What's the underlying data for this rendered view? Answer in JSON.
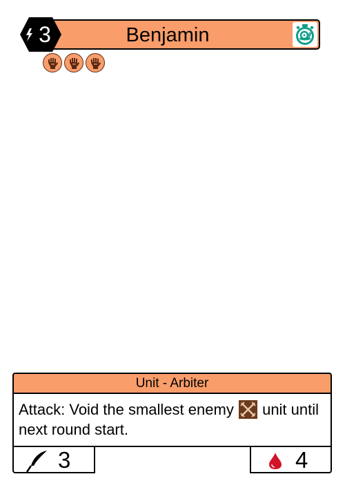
{
  "card": {
    "name": "Benjamin",
    "cost": "3",
    "speed_icon": "snail-stopwatch-icon",
    "trait_icons": [
      "claw-fist-icon",
      "claw-fist-icon",
      "claw-fist-icon"
    ],
    "type_line": "Unit - Arbiter",
    "ability": {
      "before_icon": "Attack: Void the smallest enemy",
      "icon": "crossed-swords-icon",
      "after_icon": "unit until next round start."
    },
    "attack": "3",
    "attack_icon": "quill-pen-icon",
    "health": "4",
    "health_icon": "blood-drop-icon"
  },
  "colors": {
    "accent": "#f99d6b",
    "speed_teal": "#0f9e88",
    "blood_red": "#d0142a",
    "icon_brown": "#6b3a1c"
  }
}
